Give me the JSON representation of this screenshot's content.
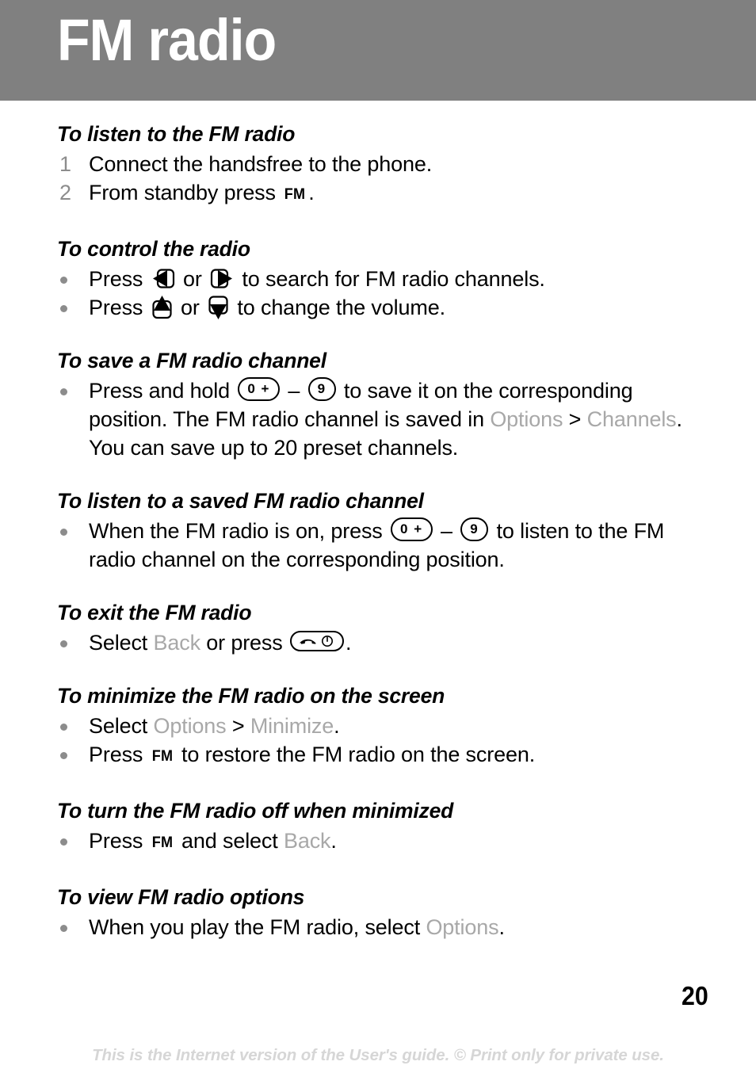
{
  "header": {
    "title": "FM radio",
    "background_color": "#808080",
    "text_color": "#ffffff"
  },
  "colors": {
    "menu_reference": "#a8a8a8",
    "marker": "#8c8c8c",
    "footer": "#d6d6d6",
    "body_text": "#000000"
  },
  "sections": [
    {
      "heading": "To listen to the FM radio",
      "items": [
        {
          "marker": "1",
          "text_before": "Connect the handsfree to the phone.",
          "text_after": ""
        },
        {
          "marker": "2",
          "text_before": "From standby press ",
          "key": "FM",
          "text_after": "."
        }
      ]
    },
    {
      "heading": "To control the radio",
      "items": [
        {
          "marker": "•",
          "text_before": "Press ",
          "key_left": "nav-left-key",
          "text_middle": " or ",
          "key_right": "nav-right-key",
          "text_after": " to search for FM radio channels."
        },
        {
          "marker": "•",
          "text_before": "Press ",
          "key_left": "nav-up-key",
          "text_middle": " or ",
          "key_right": "nav-down-key",
          "text_after": " to change the volume."
        }
      ]
    },
    {
      "heading": "To save a FM radio channel",
      "items": [
        {
          "marker": "•",
          "text_before": "Press and hold ",
          "key_from": "0 +",
          "dash": " – ",
          "key_to": "9",
          "text_mid_1": " to save it on the corresponding position. The FM radio channel is saved in ",
          "menu_1": "Options",
          "sep": " > ",
          "menu_2": "Channels",
          "text_after": ". You can save up to 20 preset channels."
        }
      ]
    },
    {
      "heading": "To listen to a saved FM radio channel",
      "items": [
        {
          "marker": "•",
          "text_before": "When the FM radio is on, press ",
          "key_from": "0 +",
          "dash": " – ",
          "key_to": "9",
          "text_after": " to listen to the FM radio channel on the corresponding position."
        }
      ]
    },
    {
      "heading": "To exit the FM radio",
      "items": [
        {
          "marker": "•",
          "text_before": "Select ",
          "menu_1": "Back",
          "text_middle": " or press ",
          "key": "end-call-key",
          "text_after": "."
        }
      ]
    },
    {
      "heading": "To minimize the FM radio on the screen",
      "items": [
        {
          "marker": "•",
          "text_before": "Select ",
          "menu_1": "Options",
          "sep": " > ",
          "menu_2": "Minimize",
          "text_after": "."
        },
        {
          "marker": "•",
          "text_before": "Press ",
          "key": "FM",
          "text_after": " to restore the FM radio on the screen."
        }
      ]
    },
    {
      "heading": "To turn the FM radio off when minimized",
      "items": [
        {
          "marker": "•",
          "text_before": "Press ",
          "key": "FM",
          "text_middle": " and select ",
          "menu_1": "Back",
          "text_after": "."
        }
      ]
    },
    {
      "heading": "To view FM radio options",
      "items": [
        {
          "marker": "•",
          "text_before": "When you play the FM radio, select ",
          "menu_1": "Options",
          "text_after": "."
        }
      ]
    }
  ],
  "page_number": "20",
  "footer": "This is the Internet version of the User's guide. © Print only for private use."
}
